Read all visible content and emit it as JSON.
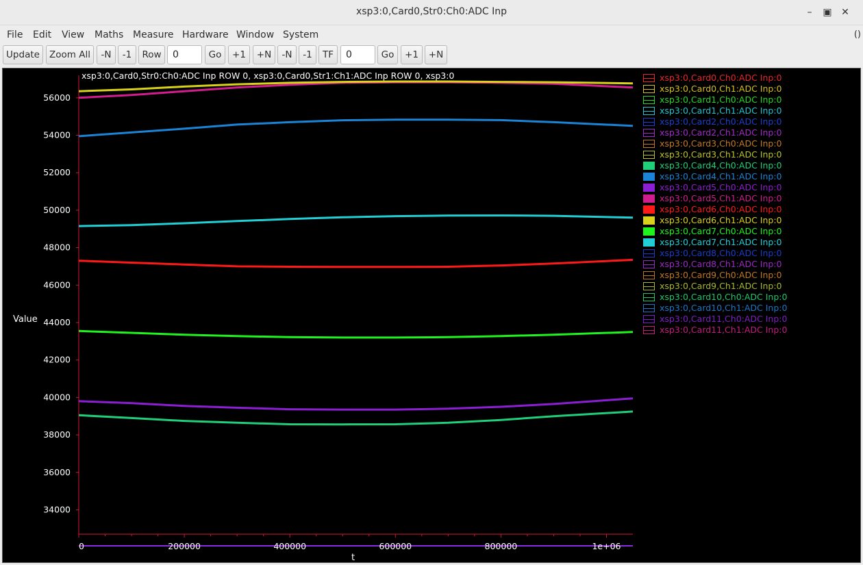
{
  "window": {
    "title": "xsp3:0,Card0,Str0:Ch0:ADC Inp"
  },
  "menu": {
    "items": [
      "File",
      "Edit",
      "View",
      "Maths",
      "Measure",
      "Hardware",
      "Window",
      "System"
    ],
    "right_label": "()"
  },
  "toolbar": {
    "update_label": "Update",
    "zoom_all_label": "Zoom All",
    "minus_n_label": "-N",
    "minus_1_label": "-1",
    "row_label": "Row",
    "row_value": "0",
    "go_label": "Go",
    "plus_1_label": "+1",
    "plus_n_label": "+N",
    "minus_n2_label": "-N",
    "minus_1b_label": "-1",
    "tf_label": "TF",
    "tf_value": "0",
    "go2_label": "Go",
    "plus_1b_label": "+1",
    "plus_n2_label": "+N"
  },
  "chart_data": {
    "type": "line",
    "title": "xsp3:0,Card0,Str0:Ch0:ADC Inp ROW 0, xsp3:0,Card0,Str1:Ch1:ADC Inp ROW 0, xsp3:0",
    "xlabel": "t",
    "ylabel": "Value",
    "xlim": [
      0,
      1050000
    ],
    "ylim": [
      32700,
      57200
    ],
    "x_ticks": [
      0,
      200000,
      400000,
      600000,
      800000,
      1000000
    ],
    "x_tick_labels": [
      "0",
      "200000",
      "400000",
      "600000",
      "800000",
      "1e+06"
    ],
    "y_ticks": [
      34000,
      36000,
      38000,
      40000,
      42000,
      44000,
      46000,
      48000,
      50000,
      52000,
      54000,
      56000
    ],
    "y_tick_labels": [
      "34000",
      "36000",
      "38000",
      "40000",
      "42000",
      "44000",
      "46000",
      "48000",
      "50000",
      "52000",
      "54000",
      "56000"
    ],
    "grid": false,
    "legend_position": "right",
    "x": [
      0,
      100000,
      200000,
      300000,
      400000,
      500000,
      600000,
      700000,
      800000,
      900000,
      1050000
    ],
    "series": [
      {
        "name": "xsp3:0,Card0,Ch0:ADC Inp:0",
        "color": "#e8262b",
        "filled": false,
        "values": []
      },
      {
        "name": "xsp3:0,Card0,Ch1:ADC Inp:0",
        "color": "#d4c21a",
        "filled": false,
        "values": []
      },
      {
        "name": "xsp3:0,Card1,Ch0:ADC Inp:0",
        "color": "#27d827",
        "filled": false,
        "values": []
      },
      {
        "name": "xsp3:0,Card1,Ch1:ADC Inp:0",
        "color": "#23c4cf",
        "filled": false,
        "values": []
      },
      {
        "name": "xsp3:0,Card2,Ch0:ADC Inp:0",
        "color": "#1f3fd0",
        "filled": false,
        "values": []
      },
      {
        "name": "xsp3:0,Card2,Ch1:ADC Inp:0",
        "color": "#a22bc7",
        "filled": false,
        "values": []
      },
      {
        "name": "xsp3:0,Card3,Ch0:ADC Inp:0",
        "color": "#c47a22",
        "filled": false,
        "values": []
      },
      {
        "name": "xsp3:0,Card3,Ch1:ADC Inp:0",
        "color": "#b9c424",
        "filled": false,
        "values": []
      },
      {
        "name": "xsp3:0,Card4,Ch0:ADC Inp:0",
        "color": "#1fcf7a",
        "filled": true,
        "values": [
          39050,
          38900,
          38750,
          38650,
          38570,
          38560,
          38570,
          38650,
          38800,
          39000,
          39250
        ]
      },
      {
        "name": "xsp3:0,Card4,Ch1:ADC Inp:0",
        "color": "#1b84d6",
        "filled": true,
        "values": [
          53950,
          54150,
          54350,
          54570,
          54700,
          54800,
          54830,
          54830,
          54810,
          54700,
          54500
        ]
      },
      {
        "name": "xsp3:0,Card5,Ch0:ADC Inp:0",
        "color": "#8c1fd3",
        "filled": true,
        "values": [
          39800,
          39700,
          39550,
          39450,
          39370,
          39350,
          39350,
          39400,
          39500,
          39650,
          39950
        ]
      },
      {
        "name": "xsp3:0,Card5,Ch1:ADC Inp:0",
        "color": "#d11d8d",
        "filled": true,
        "values": [
          56000,
          56150,
          56350,
          56550,
          56700,
          56800,
          56830,
          56830,
          56800,
          56750,
          56550
        ]
      },
      {
        "name": "xsp3:0,Card6,Ch0:ADC Inp:0",
        "color": "#ff1a1a",
        "filled": true,
        "values": [
          47300,
          47200,
          47100,
          47000,
          46980,
          46970,
          46970,
          46980,
          47050,
          47150,
          47350
        ]
      },
      {
        "name": "xsp3:0,Card6,Ch1:ADC Inp:0",
        "color": "#d8d21b",
        "filled": true,
        "values": [
          56350,
          56450,
          56600,
          56720,
          56800,
          56850,
          56870,
          56870,
          56850,
          56830,
          56770
        ]
      },
      {
        "name": "xsp3:0,Card7,Ch0:ADC Inp:0",
        "color": "#1ff41f",
        "filled": true,
        "values": [
          43550,
          43450,
          43350,
          43280,
          43220,
          43200,
          43200,
          43220,
          43280,
          43350,
          43500
        ]
      },
      {
        "name": "xsp3:0,Card7,Ch1:ADC Inp:0",
        "color": "#22cfd6",
        "filled": true,
        "values": [
          49150,
          49200,
          49300,
          49420,
          49530,
          49620,
          49680,
          49710,
          49720,
          49700,
          49600
        ]
      },
      {
        "name": "xsp3:0,Card8,Ch0:ADC Inp:0",
        "color": "#1c3cc9",
        "filled": false,
        "values": []
      },
      {
        "name": "xsp3:0,Card8,Ch1:ADC Inp:0",
        "color": "#9b2ac3",
        "filled": false,
        "values": []
      },
      {
        "name": "xsp3:0,Card9,Ch0:ADC Inp:0",
        "color": "#c27822",
        "filled": false,
        "values": []
      },
      {
        "name": "xsp3:0,Card9,Ch1:ADC Inp:0",
        "color": "#a9b82b",
        "filled": false,
        "values": []
      },
      {
        "name": "xsp3:0,Card10,Ch0:ADC Inp:0",
        "color": "#20c76c",
        "filled": false,
        "values": []
      },
      {
        "name": "xsp3:0,Card10,Ch1:ADC Inp:0",
        "color": "#1e76c8",
        "filled": false,
        "values": []
      },
      {
        "name": "xsp3:0,Card11,Ch0:ADC Inp:0",
        "color": "#7e1fc6",
        "filled": false,
        "values": []
      },
      {
        "name": "xsp3:0,Card11,Ch1:ADC Inp:0",
        "color": "#c41d7f",
        "filled": false,
        "values": []
      }
    ],
    "axis_color": "#d21b2b"
  }
}
